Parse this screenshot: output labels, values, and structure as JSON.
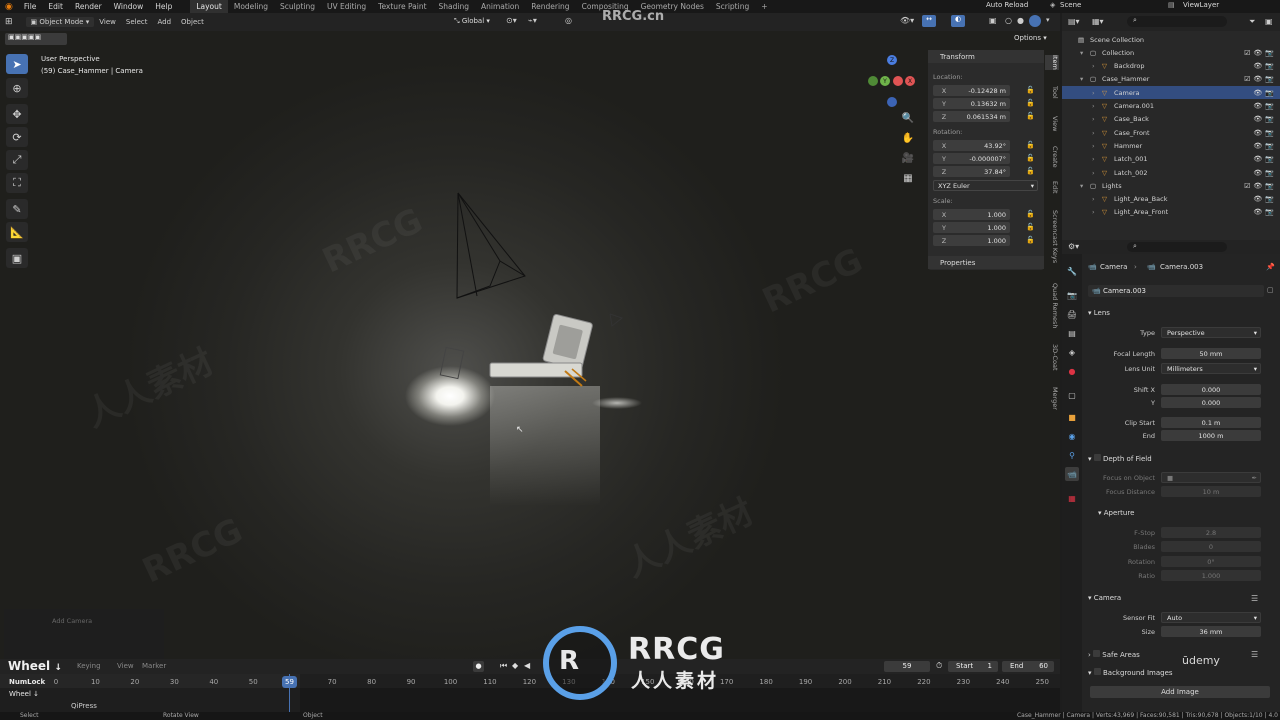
{
  "top_menu": {
    "menus": [
      "File",
      "Edit",
      "Render",
      "Window",
      "Help"
    ],
    "workspaces": [
      "Layout",
      "Modeling",
      "Sculpting",
      "UV Editing",
      "Texture Paint",
      "Shading",
      "Animation",
      "Rendering",
      "Compositing",
      "Geometry Nodes",
      "Scripting",
      "+"
    ],
    "active_workspace": "Layout",
    "auto_reload": "Auto Reload",
    "scene": "Scene",
    "view_layer": "ViewLayer"
  },
  "viewport_header": {
    "mode": "Object Mode",
    "menus": [
      "View",
      "Select",
      "Add",
      "Object"
    ],
    "transform_orientation": "Global",
    "options": "Options"
  },
  "viewport": {
    "view_name": "User Perspective",
    "object_info": "(59) Case_Hammer | Camera",
    "gizmo_labels": [
      "Z",
      "Y",
      "X"
    ],
    "operator_panel": "Add Camera",
    "key_hint_main": "Wheel",
    "key_hint_main_icon": "↓",
    "key_hints": [
      "NumLock",
      "Wheel ↓"
    ],
    "key_hint_bottom": "QiPress"
  },
  "n_panel": {
    "section_transform": "Transform",
    "location_label": "Location:",
    "location": {
      "x": "-0.12428 m",
      "y": "0.13632 m",
      "z": "0.061534 m"
    },
    "rotation_label": "Rotation:",
    "rotation": {
      "x": "43.92°",
      "y": "-0.000007°",
      "z": "37.84°"
    },
    "rotation_mode": "XYZ Euler",
    "scale_label": "Scale:",
    "scale": {
      "x": "1.000",
      "y": "1.000",
      "z": "1.000"
    },
    "section_properties": "Properties",
    "axis": [
      "X",
      "Y",
      "Z"
    ],
    "side_tabs": [
      "Item",
      "Tool",
      "View",
      "Create",
      "Edit",
      "Screencast Keys",
      "Quad Remesh",
      "3D-Coat",
      "Merger"
    ]
  },
  "outliner": {
    "rows": [
      {
        "name": "Scene Collection",
        "depth": 0
      },
      {
        "name": "Collection",
        "depth": 1
      },
      {
        "name": "Backdrop",
        "depth": 2
      },
      {
        "name": "Case_Hammer",
        "depth": 1
      },
      {
        "name": "Camera",
        "depth": 2,
        "selected": true
      },
      {
        "name": "Camera.001",
        "depth": 2
      },
      {
        "name": "Case_Back",
        "depth": 2
      },
      {
        "name": "Case_Front",
        "depth": 2
      },
      {
        "name": "Hammer",
        "depth": 2
      },
      {
        "name": "Latch_001",
        "depth": 2
      },
      {
        "name": "Latch_002",
        "depth": 2
      },
      {
        "name": "Lights",
        "depth": 1
      },
      {
        "name": "Light_Area_Back",
        "depth": 2
      },
      {
        "name": "Light_Area_Front",
        "depth": 2
      }
    ]
  },
  "properties": {
    "breadcrumb_object": "Camera",
    "breadcrumb_data": "Camera.003",
    "datablock": "Camera.003",
    "lens_section": "Lens",
    "type_label": "Type",
    "type_value": "Perspective",
    "focal_label": "Focal Length",
    "focal_value": "50 mm",
    "lens_unit_label": "Lens Unit",
    "lens_unit_value": "Millimeters",
    "shift_x_label": "Shift X",
    "shift_x_value": "0.000",
    "shift_y_label": "Y",
    "shift_y_value": "0.000",
    "clip_start_label": "Clip Start",
    "clip_start_value": "0.1 m",
    "clip_end_label": "End",
    "clip_end_value": "1000 m",
    "dof_section": "Depth of Field",
    "focus_object_label": "Focus on Object",
    "focus_distance_label": "Focus Distance",
    "focus_distance_value": "10 m",
    "aperture_section": "Aperture",
    "fstop_label": "F-Stop",
    "fstop_value": "2.8",
    "blades_label": "Blades",
    "blades_value": "0",
    "rotation_label": "Rotation",
    "rotation_value": "0°",
    "ratio_label": "Ratio",
    "ratio_value": "1.000",
    "camera_section": "Camera",
    "sensor_fit_label": "Sensor Fit",
    "sensor_fit_value": "Auto",
    "size_label": "Size",
    "size_value": "36 mm",
    "safe_areas_section": "Safe Areas",
    "bg_images_section": "Background Images",
    "add_image_button": "Add Image",
    "udemy": "ūdemy"
  },
  "timeline": {
    "menus": [
      "Keying",
      "View",
      "Marker"
    ],
    "current_frame": "59",
    "start_label": "Start",
    "start_value": "1",
    "end_label": "End",
    "end_value": "60",
    "ticks": [
      "0",
      "10",
      "20",
      "30",
      "40",
      "50",
      "70",
      "80",
      "90",
      "100",
      "110",
      "120",
      "130",
      "140",
      "150",
      "160",
      "170",
      "180",
      "190",
      "200",
      "210",
      "220",
      "230",
      "240",
      "250"
    ]
  },
  "status_bar": {
    "select": "Select",
    "rotate": "Rotate View",
    "object": "Object",
    "stats": "Case_Hammer | Camera | Verts:43,969 | Faces:90,581 | Tris:90,678 | Objects:1/10 | 4.0"
  },
  "watermark": {
    "brand": "RRCG",
    "brand_sub": "人人素材",
    "top": "RRCG.cn"
  },
  "colors": {
    "accent": "#4772b3",
    "selected_row": "#334d80",
    "header": "#232323"
  }
}
